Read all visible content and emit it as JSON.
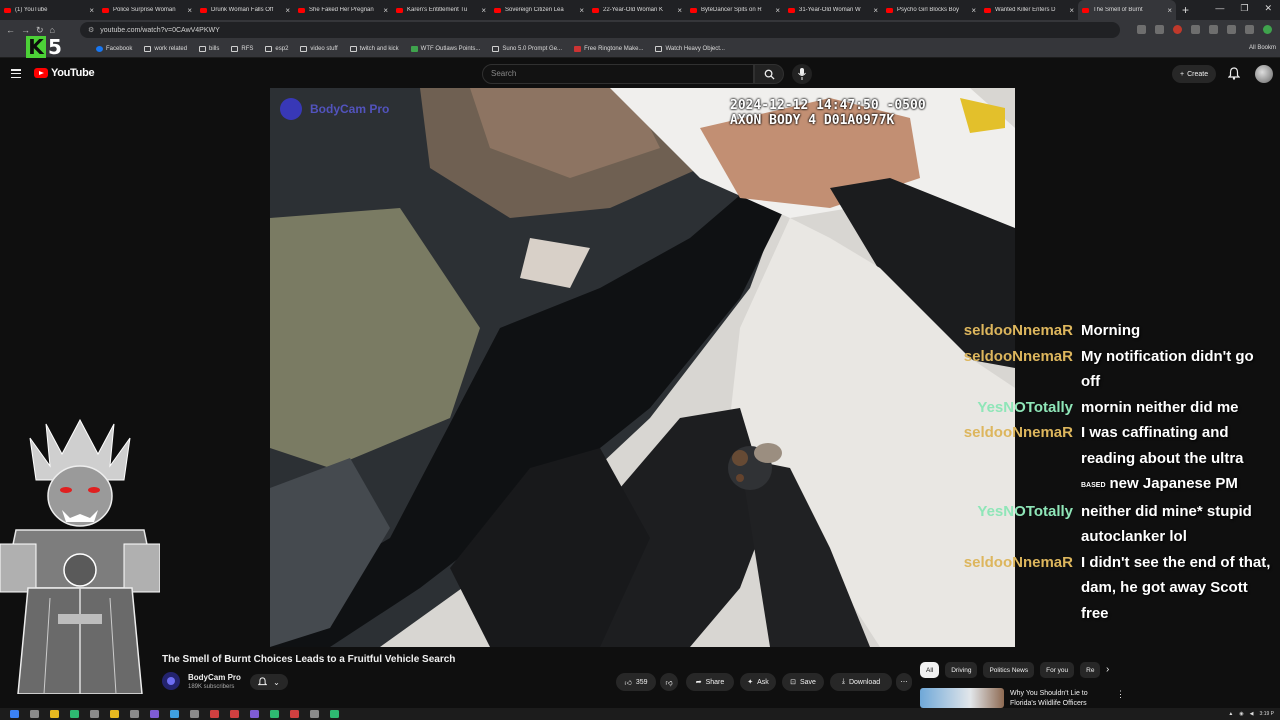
{
  "browser": {
    "tabs": [
      {
        "title": "(1) YouTube"
      },
      {
        "title": "Police Surprise Woman"
      },
      {
        "title": "Drunk Woman Falls Off"
      },
      {
        "title": "She Faked Her Pregnan"
      },
      {
        "title": "Karen's Entitlement Tu"
      },
      {
        "title": "Sovereign Citizen Lea"
      },
      {
        "title": "22-Year-Old Woman K"
      },
      {
        "title": "ByteDancer Spits on R"
      },
      {
        "title": "31-Year-Old Woman W"
      },
      {
        "title": "Psycho Girl Blocks Boy"
      },
      {
        "title": "Wanted Killer Enters D"
      },
      {
        "title": "The Smell of Burnt"
      }
    ],
    "new_tab": "+",
    "url": "youtube.com/watch?v=0CAwV4PKWY",
    "bookmarks": [
      {
        "label": "Facebook",
        "icon": "facebook-icon"
      },
      {
        "label": "work related",
        "icon": "folder-icon"
      },
      {
        "label": "bills",
        "icon": "folder-icon"
      },
      {
        "label": "RFS",
        "icon": "folder-icon"
      },
      {
        "label": "esp2",
        "icon": "folder-icon"
      },
      {
        "label": "video stuff",
        "icon": "folder-icon"
      },
      {
        "label": "twitch and kick",
        "icon": "folder-icon"
      },
      {
        "label": "WTF Outlaws Points...",
        "icon": "link-icon"
      },
      {
        "label": "Suno 5.0 Prompt Ge...",
        "icon": "link-icon"
      },
      {
        "label": "Free Ringtone Make...",
        "icon": "link-icon"
      },
      {
        "label": "Watch Heavy Object...",
        "icon": "link-icon"
      }
    ],
    "all_bookmarks": "All Bookm"
  },
  "overlay": {
    "k5_letter": "K",
    "k5_number": "5"
  },
  "youtube": {
    "logo_text": "YouTube",
    "search_placeholder": "Search",
    "create_label": "Create"
  },
  "video": {
    "watermark": "BodyCam Pro",
    "timestamp_line1": "2024-12-12 14:47:50 -0500",
    "timestamp_line2": "AXON BODY 4 D01A0977K",
    "title": "The Smell of Burnt Choices Leads to a Fruitful Vehicle Search",
    "channel": "BodyCam Pro",
    "subscribers": "189K subscribers",
    "likes": "359",
    "share_label": "Share",
    "ask_label": "Ask",
    "save_label": "Save",
    "download_label": "Download"
  },
  "chat": [
    {
      "user": "seldooNnemaR",
      "text": "Morning",
      "color": "#ddb65d"
    },
    {
      "user": "seldooNnemaR",
      "text": "My notification didn't go off",
      "color": "#ddb65d"
    },
    {
      "user": "YesNOTotally",
      "text": "mornin neither did me",
      "color": "#8fe6b8"
    },
    {
      "user": "seldooNnemaR",
      "text": "I was caffinating and reading about the ultra",
      "badge": "BASED",
      "text_after_badge": "new Japanese PM",
      "color": "#ddb65d"
    },
    {
      "user": "YesNOTotally",
      "text": "neither did mine* stupid autoclanker lol",
      "color": "#8fe6b8"
    },
    {
      "user": "seldooNnemaR",
      "text": "I didn't see the end of that, dam, he got away Scott free",
      "color": "#ddb65d"
    }
  ],
  "sidebar": {
    "chips": [
      "All",
      "Driving",
      "Politics News",
      "For you",
      "Re"
    ],
    "recommended_title": "Why You Shouldn't Lie to Florida's Wildlife Officers"
  },
  "taskbar": {
    "clock": "3:19 P"
  }
}
